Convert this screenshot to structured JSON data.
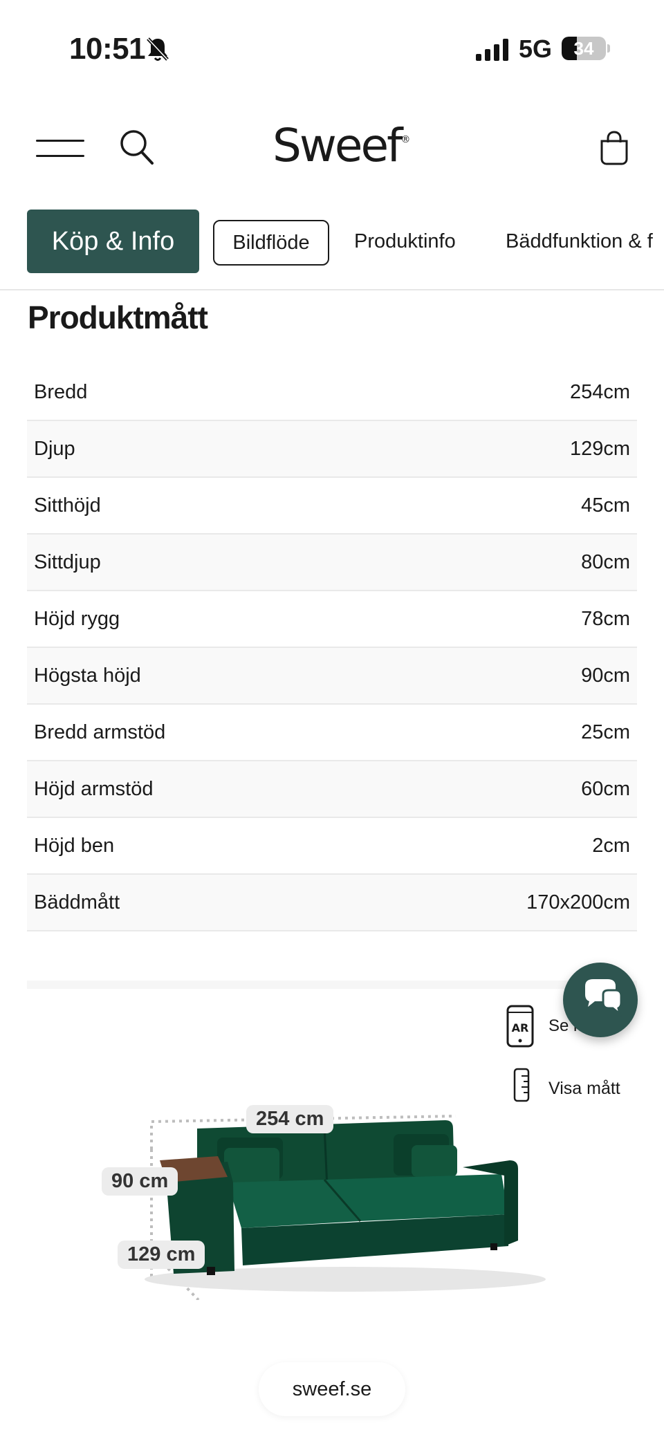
{
  "status_bar": {
    "time": "10:51",
    "network": "5G",
    "battery": "34",
    "battery_level": 0.34
  },
  "header": {
    "logo": "Sweef",
    "logo_mark": "®"
  },
  "tabs": [
    {
      "label": "Köp & Info",
      "state": "active"
    },
    {
      "label": "Bildflöde",
      "state": "outlined"
    },
    {
      "label": "Produktinfo",
      "state": "plain"
    },
    {
      "label": "Bäddfunktion & f",
      "state": "plain"
    }
  ],
  "section": {
    "title": "Produktmått",
    "rows": [
      {
        "label": "Bredd",
        "value": "254cm"
      },
      {
        "label": "Djup",
        "value": "129cm"
      },
      {
        "label": "Sitthöjd",
        "value": "45cm"
      },
      {
        "label": "Sittdjup",
        "value": "80cm"
      },
      {
        "label": "Höjd rygg",
        "value": "78cm"
      },
      {
        "label": "Högsta höjd",
        "value": "90cm"
      },
      {
        "label": "Bredd armstöd",
        "value": "25cm"
      },
      {
        "label": "Höjd armstöd",
        "value": "60cm"
      },
      {
        "label": "Höjd ben",
        "value": "2cm"
      },
      {
        "label": "Bäddmått",
        "value": "170x200cm"
      }
    ]
  },
  "viewer": {
    "ar_label": "Se i",
    "ar_icon_text": "AR",
    "measure_label": "Visa mått",
    "dim_width": "254 cm",
    "dim_height": "90 cm",
    "dim_depth": "129 cm",
    "sofa_color": "#0f4a33"
  },
  "footer": {
    "domain": "sweef.se"
  },
  "colors": {
    "accent": "#2e5550"
  }
}
